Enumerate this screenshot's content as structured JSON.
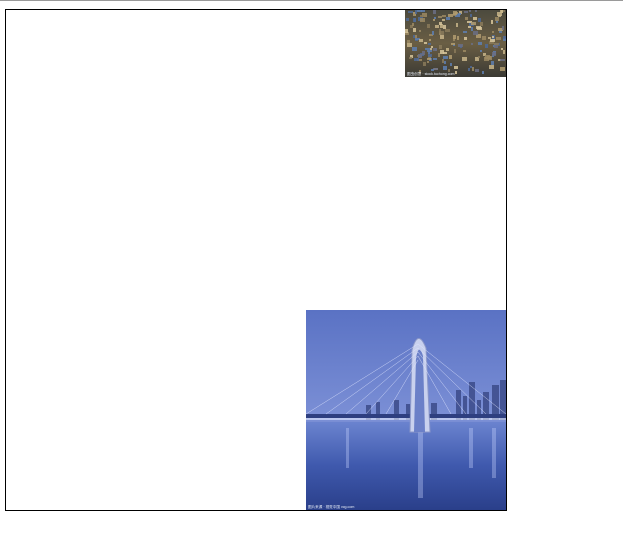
{
  "thumbnails": [
    {
      "subject": "hillside city with dense houses",
      "caption": "图虫创意 · stock.tuchong.com"
    },
    {
      "subject": "cable-stayed bridge at dusk over river",
      "caption": "图片来源 · 视觉中国 vcg.com"
    }
  ],
  "colors": {
    "frame_border": "#000000",
    "top_rule": "#9a9a9a",
    "bridge_sky": "#5a73c6",
    "city_tone": "#6a5a3a"
  }
}
